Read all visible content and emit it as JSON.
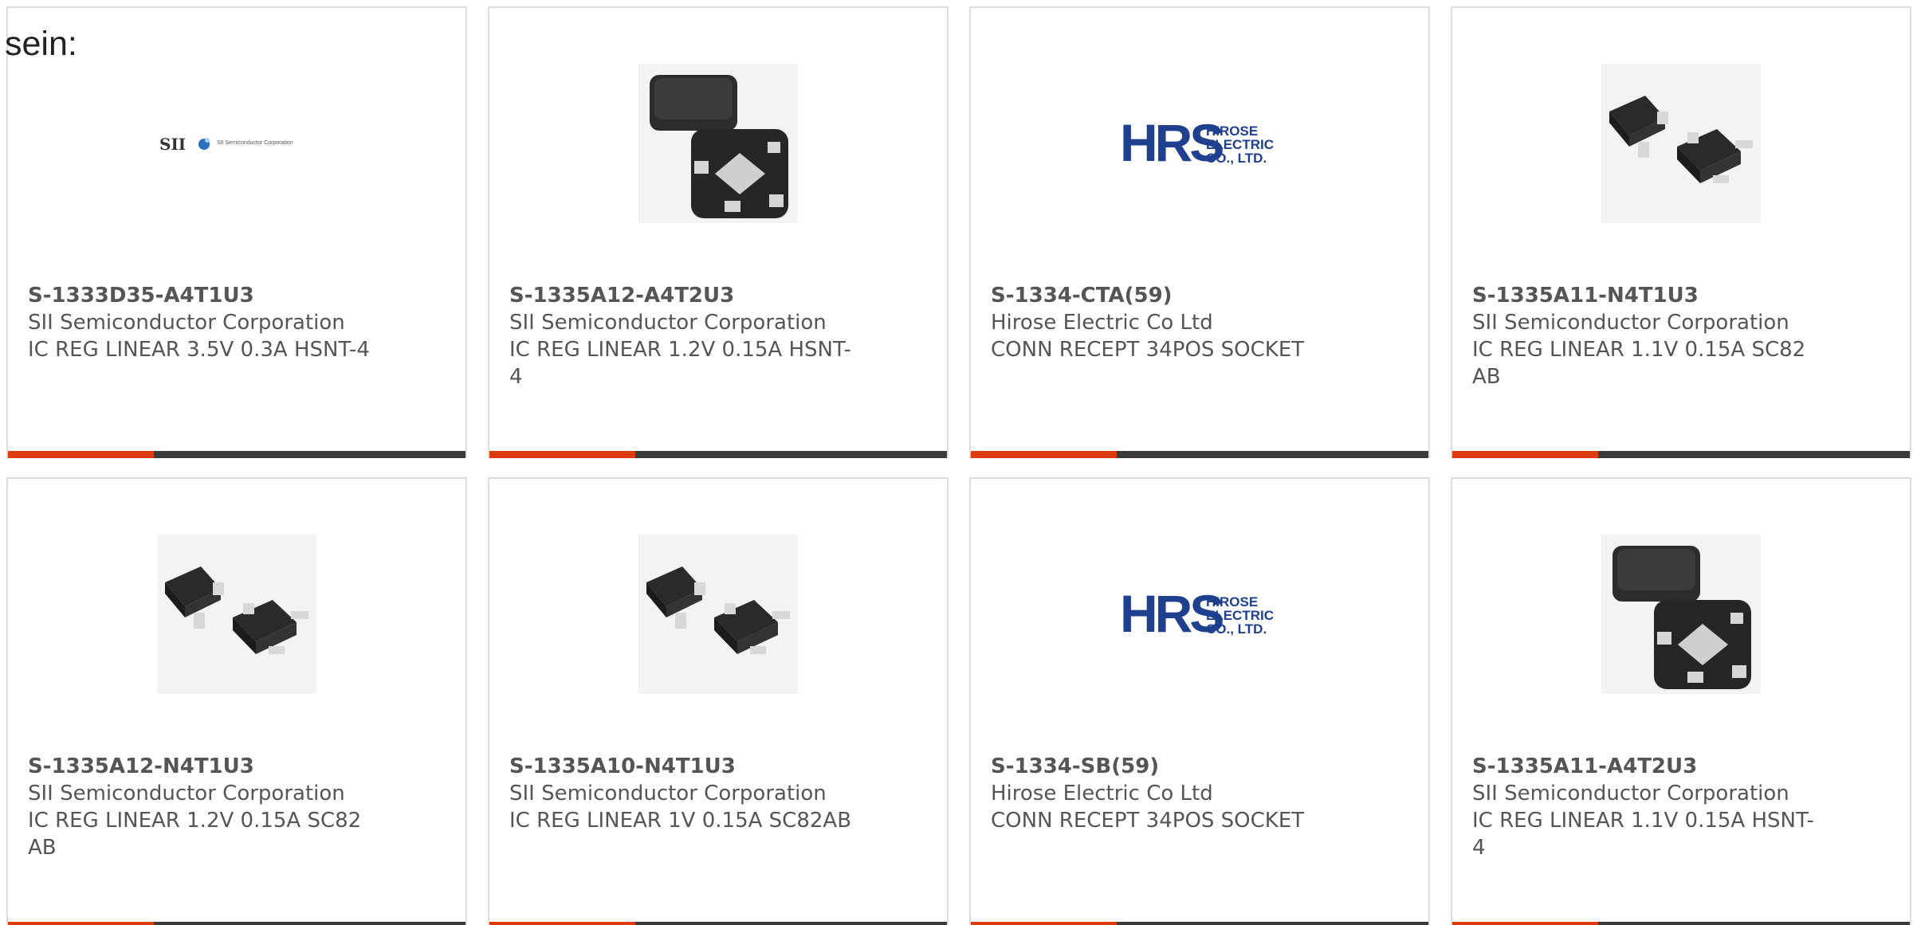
{
  "heading": "sein:",
  "colors": {
    "accent": "#dc3c0a",
    "bar": "#3a3a3a",
    "text": "#555555",
    "hrs_blue": "#1f3f8f"
  },
  "cards": [
    {
      "part": "S-1333D35-A4T1U3",
      "manufacturer": "SII Semiconductor Corporation",
      "description": "IC REG LINEAR 3.5V 0.3A HSNT-4",
      "image": "sii-logo",
      "logo_letters": "SII",
      "logo_caption": "SII Semiconductor Corporation"
    },
    {
      "part": "S-1335A12-A4T2U3",
      "manufacturer": "SII Semiconductor Corporation",
      "description": "IC REG LINEAR 1.2V 0.15A HSNT-4",
      "image": "hsnt-package"
    },
    {
      "part": "S-1334-CTA(59)",
      "manufacturer": "Hirose Electric Co Ltd",
      "description": "CONN RECEPT 34POS SOCKET",
      "image": "hrs-logo",
      "logo_letters": "HRS",
      "logo_lines": [
        "HIROSE",
        "ELECTRIC",
        "CO., LTD."
      ]
    },
    {
      "part": "S-1335A11-N4T1U3",
      "manufacturer": "SII Semiconductor Corporation",
      "description": "IC REG LINEAR 1.1V 0.15A SC82AB",
      "image": "sc82ab-package"
    },
    {
      "part": "S-1335A12-N4T1U3",
      "manufacturer": "SII Semiconductor Corporation",
      "description": "IC REG LINEAR 1.2V 0.15A SC82AB",
      "image": "sc82ab-package"
    },
    {
      "part": "S-1335A10-N4T1U3",
      "manufacturer": "SII Semiconductor Corporation",
      "description": "IC REG LINEAR 1V 0.15A SC82AB",
      "image": "sc82ab-package"
    },
    {
      "part": "S-1334-SB(59)",
      "manufacturer": "Hirose Electric Co Ltd",
      "description": "CONN RECEPT 34POS SOCKET",
      "image": "hrs-logo",
      "logo_letters": "HRS",
      "logo_lines": [
        "HIROSE",
        "ELECTRIC",
        "CO., LTD."
      ]
    },
    {
      "part": "S-1335A11-A4T2U3",
      "manufacturer": "SII Semiconductor Corporation",
      "description": "IC REG LINEAR 1.1V 0.15A HSNT-4",
      "image": "hsnt-package"
    }
  ]
}
